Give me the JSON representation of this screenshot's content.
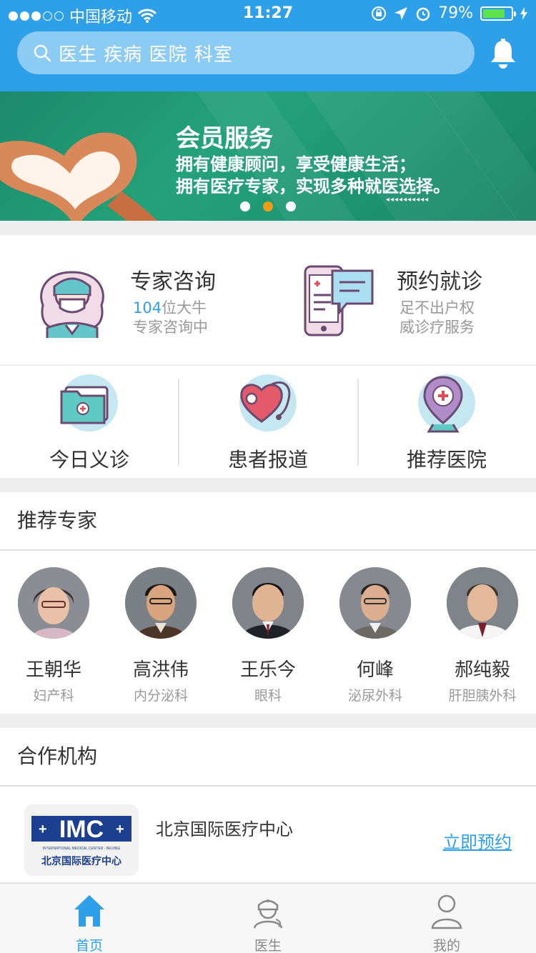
{
  "status_bar": {
    "carrier": "中国移动",
    "time": "11:27",
    "battery": "79%",
    "signal_dots_filled": 3,
    "signal_dots_total": 5,
    "battery_level": 0.79
  },
  "search": {
    "placeholder": "医生  疾病  医院  科室",
    "icon": "search-icon"
  },
  "header": {
    "notification_icon": "bell-icon"
  },
  "banner": {
    "title": "会员服务",
    "line1": "拥有健康顾问，享受健康生活；",
    "line2": "拥有医疗专家，实现多种就医选择。",
    "arrows": "◂◂◂◂◂◂◂◂◂◂",
    "page_count": 3,
    "active_page": 2
  },
  "consult": {
    "expert": {
      "title": "专家咨询",
      "count": "104",
      "sub1_suffix": "位大牛",
      "sub2": "专家咨询中"
    },
    "appointment": {
      "title": "预约就诊",
      "sub1": "足不出户权",
      "sub2": "威诊疗服务"
    }
  },
  "quick": [
    {
      "label": "今日义诊",
      "icon": "folder-medical-icon"
    },
    {
      "label": "患者报道",
      "icon": "stethoscope-heart-icon"
    },
    {
      "label": "推荐医院",
      "icon": "hospital-location-icon"
    }
  ],
  "experts_section": {
    "title": "推荐专家",
    "experts": [
      {
        "name": "王朝华",
        "dept": "妇产科"
      },
      {
        "name": "高洪伟",
        "dept": "内分泌科"
      },
      {
        "name": "王乐今",
        "dept": "眼科"
      },
      {
        "name": "何峰",
        "dept": "泌尿外科"
      },
      {
        "name": "郝纯毅",
        "dept": "肝胆胰外科"
      }
    ]
  },
  "partners_section": {
    "title": "合作机构",
    "items": [
      {
        "name": "北京国际医疗中心",
        "action": "立即预约",
        "logo_text": "IMC",
        "logo_subtitle": "INTERNATIONAL MEDICAL CENTER · BEIJING",
        "logo_cn": "北京国际医疗中心"
      }
    ]
  },
  "tabbar": [
    {
      "label": "首页",
      "icon": "home-icon",
      "active": true
    },
    {
      "label": "医生",
      "icon": "doctor-icon",
      "active": false
    },
    {
      "label": "我的",
      "icon": "profile-icon",
      "active": false
    }
  ],
  "colors": {
    "primary": "#2ea0ea",
    "banner_green": "#24a27a",
    "pager_active": "#f29b16",
    "text_dark": "#333333",
    "text_muted": "#999999"
  }
}
